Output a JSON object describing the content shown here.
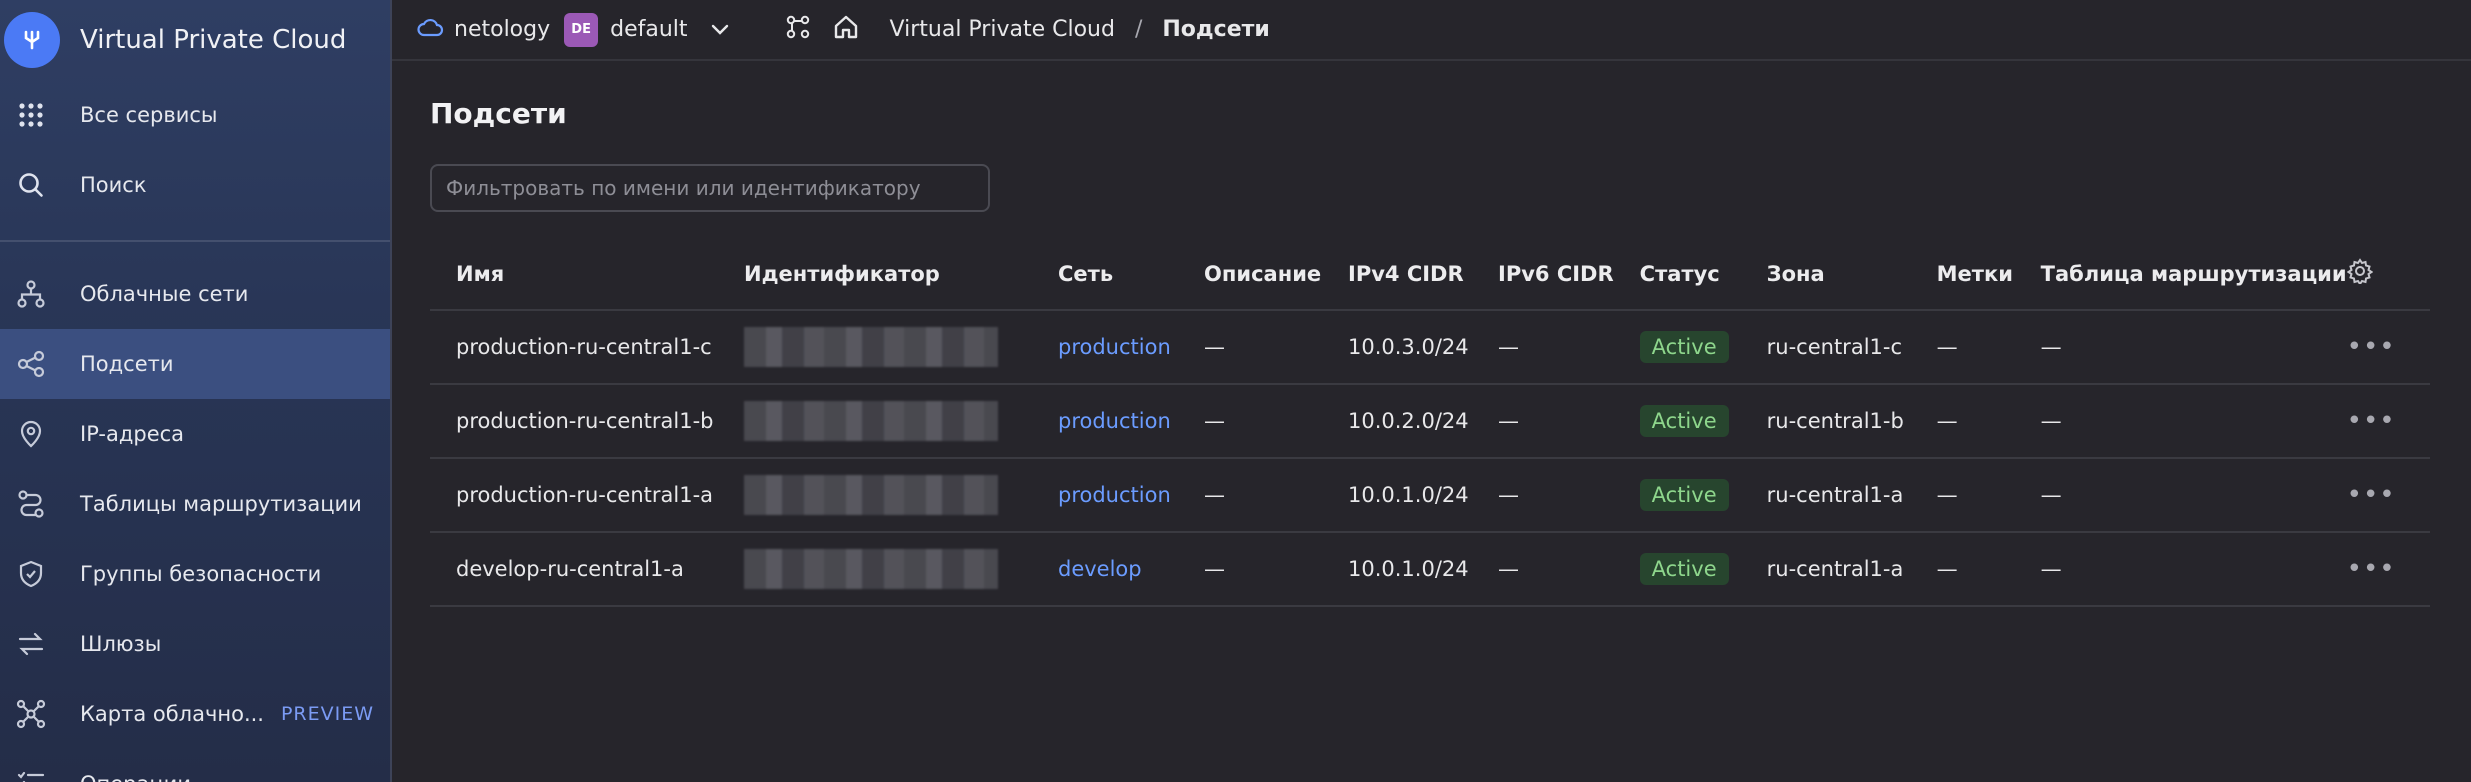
{
  "sidebar": {
    "title": "Virtual Private Cloud",
    "top_items": [
      {
        "label": "Все сервисы",
        "icon": "grid-icon"
      },
      {
        "label": "Поиск",
        "icon": "search-icon"
      }
    ],
    "items": [
      {
        "label": "Облачные сети",
        "icon": "network-icon"
      },
      {
        "label": "Подсети",
        "icon": "subnet-icon",
        "active": true
      },
      {
        "label": "IP-адреса",
        "icon": "location-pin-icon"
      },
      {
        "label": "Таблицы маршрутизации",
        "icon": "route-icon"
      },
      {
        "label": "Группы безопасности",
        "icon": "shield-icon"
      },
      {
        "label": "Шлюзы",
        "icon": "arrows-exchange-icon"
      },
      {
        "label": "Карта облачно...",
        "icon": "graph-icon",
        "badge": "PREVIEW"
      },
      {
        "label": "Операции",
        "icon": "list-check-icon"
      }
    ]
  },
  "topbar": {
    "cloud": "netology",
    "folder_badge": "DE",
    "folder": "default",
    "breadcrumb_service": "Virtual Private Cloud",
    "breadcrumb_separator": "/",
    "breadcrumb_page": "Подсети"
  },
  "main": {
    "title": "Подсети",
    "filter_placeholder": "Фильтровать по имени или идентификатору",
    "columns": [
      "Имя",
      "Идентификатор",
      "Сеть",
      "Описание",
      "IPv4 CIDR",
      "IPv6 CIDR",
      "Статус",
      "Зона",
      "Метки",
      "Таблица маршрутизации"
    ],
    "rows": [
      {
        "name": "production-ru-central1-c",
        "network": "production",
        "description": "—",
        "ipv4": "10.0.3.0/24",
        "ipv6": "—",
        "status": "Active",
        "zone": "ru-central1-c",
        "labels": "—",
        "route_table": "—"
      },
      {
        "name": "production-ru-central1-b",
        "network": "production",
        "description": "—",
        "ipv4": "10.0.2.0/24",
        "ipv6": "—",
        "status": "Active",
        "zone": "ru-central1-b",
        "labels": "—",
        "route_table": "—"
      },
      {
        "name": "production-ru-central1-a",
        "network": "production",
        "description": "—",
        "ipv4": "10.0.1.0/24",
        "ipv6": "—",
        "status": "Active",
        "zone": "ru-central1-a",
        "labels": "—",
        "route_table": "—"
      },
      {
        "name": "develop-ru-central1-a",
        "network": "develop",
        "description": "—",
        "ipv4": "10.0.1.0/24",
        "ipv6": "—",
        "status": "Active",
        "zone": "ru-central1-a",
        "labels": "—",
        "route_table": "—"
      }
    ],
    "row_menu": "•••"
  },
  "colors": {
    "accent": "#4b7af5",
    "link": "#6b9cff",
    "status_bg": "#27452e",
    "status_text": "#8ed68c",
    "background": "#26252b"
  }
}
